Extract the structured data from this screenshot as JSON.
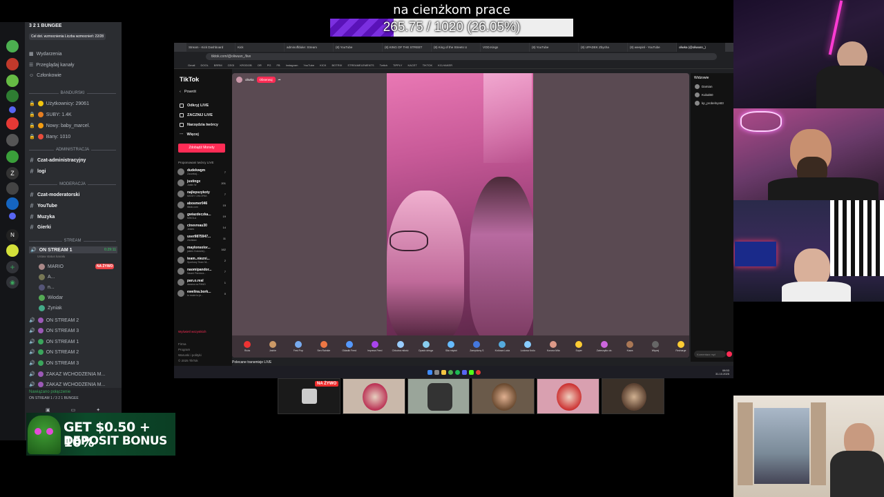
{
  "overlay": {
    "goal_title": "na cienżkom prace",
    "progress_text": "265.75 / 1020 (26.05%)",
    "progress_fraction": 0.2605,
    "accent": "#7b2fe0"
  },
  "discord": {
    "server_name": "3 2 1 BUNGEE",
    "goal_line": "Cel dot. wzmocnienia  Liczba wzmocnień: 22/28",
    "top_items": [
      "Wydarzenia",
      "Przeglądaj kanały",
      "Członkowie"
    ],
    "category_banduski": "BANDURSKI",
    "stats": [
      "Użytkownicy: 29061",
      "SUBY: 1.4K",
      "Nowy: baby_marcel.",
      "Bany: 1010"
    ],
    "category_admin": "ADMINISTRACJA",
    "admin_channels": [
      "Czat-administracyjny",
      "logi"
    ],
    "category_mod": "MODERACJA",
    "mod_channels": [
      "Czat-moderatorski",
      "YouTube",
      "Muzyka",
      "Gierki"
    ],
    "category_stream": "STREAM",
    "active_stream": "ON STREAM 1",
    "active_stream_time": "0:29:11",
    "status_hint": "Ustaw status kanału",
    "live_label": "NA ŻYWO",
    "stream_users": [
      "MARIO",
      "A...",
      "n...",
      "Wiodar",
      "Zyniak"
    ],
    "more_streams": [
      "ON STREAM 2",
      "ON STREAM 3",
      "ON STREAM 1",
      "ON STREAM 2",
      "ON STREAM 3",
      "ZAKAZ WCHODZENIA M...",
      "ZAKAZ WCHODZENIA M..."
    ],
    "connection": "Nawiązano połączenie",
    "connection_sub": "ON STREAM 1 / 3 2 1 BUNGEE"
  },
  "casino": {
    "line1": "GET $0.50 + 10%",
    "line2": "DEPOSIT BONUS"
  },
  "browser": {
    "tabs": [
      "Stream - Kick Dashboard",
      "Kick",
      "adminoffduke: Stream",
      "(8) YouTube",
      "(8) KING OF THE STREET",
      "(8) King of the Streets U",
      "VOD.Kings",
      "(8) YouTube",
      "(8) UPADEK Zbycha",
      "(8) weepinl - YouTube",
      "oliwka (@oliwusn_)"
    ],
    "url": "tiktok.com/@oliwusn_/live",
    "bookmarks": [
      "Gmail",
      "DOOL",
      "BRRM",
      "CEGI",
      "KRODOB",
      "OR",
      "PG",
      "FB",
      "Instagram",
      "YouTube",
      "KICK",
      "BOTRIX",
      "STREAMELEMENTS",
      "Twitch",
      "TIPPLY",
      "KACET",
      "TIKTOK",
      "KG-HAKER"
    ]
  },
  "tiktok": {
    "logo": "TikTok",
    "nav": [
      "Powrót",
      "Odkryj LIVE",
      "ZACZNIJ LIVE",
      "Narzędzia twórcy",
      "Więcej"
    ],
    "coins_button": "Zdobądź Monety",
    "suggested_title": "Proponowani twórcy LIVE",
    "suggested": [
      {
        "name": "dudekwgm",
        "sub": "Zaczekaj...",
        "count": "7"
      },
      {
        "name": "justingx",
        "sub": "Justin W",
        "count": "201"
      },
      {
        "name": "najlepszykoty",
        "sub": "MIODY CHŁOPAK",
        "count": "7"
      },
      {
        "name": "abosmer046",
        "sub": "tiktok.com",
        "count": "15"
      },
      {
        "name": "gwiazdeczka...",
        "sub": "MIKOLA",
        "count": "19"
      },
      {
        "name": "cinevreau30",
        "sub": "Jesteś",
        "count": "14"
      },
      {
        "name": "user9875947...",
        "sub": "Zdzisław",
        "count": "11"
      },
      {
        "name": "maylonsolor...",
        "sub": "jakieś Gołodziej...",
        "count": "162"
      },
      {
        "name": "team..niezni...",
        "sub": "Sportowy Team Ni...",
        "count": "2"
      },
      {
        "name": "naomipandor...",
        "sub": "Naomi Pandora...",
        "count": "7"
      },
      {
        "name": "pan.o.real",
        "sub": "dwoma na PANO",
        "count": "1"
      },
      {
        "name": "ewelina.bork...",
        "sub": "to może to je...",
        "count": "0"
      }
    ],
    "show_more": "Wyświetl wszystkich",
    "footer": [
      "Firma",
      "Program",
      "Warunki i polityki",
      "© 2025 TikTok"
    ],
    "host_name": "oliwka",
    "follow": "Obserwuj",
    "gifts": [
      "Róża",
      "Joshie",
      "Fest Pop",
      "Sen Rainkie",
      "Okładki Feed",
      "Impreza Feed",
      "Chłodna miłość",
      "Opado dringa",
      "Siła mięśni",
      "Zamyślony S",
      "Królowa Loda",
      "Lodowa Królo",
      "Korona Mila",
      "Super",
      "Zwierzątko ob.",
      "Kawa",
      "Więcej",
      "Recharge"
    ],
    "recommended": "Polecane transmisje LIVE",
    "chat_title": "Widzowie",
    "viewers": [
      "Damian",
      "Kubal60",
      "kp_probelnys83"
    ],
    "comment_placeholder": "Komentarz mył",
    "clock_time": "08:53",
    "clock_date": "31.10.2025"
  },
  "thumbs_live": "NA ŻYWO"
}
